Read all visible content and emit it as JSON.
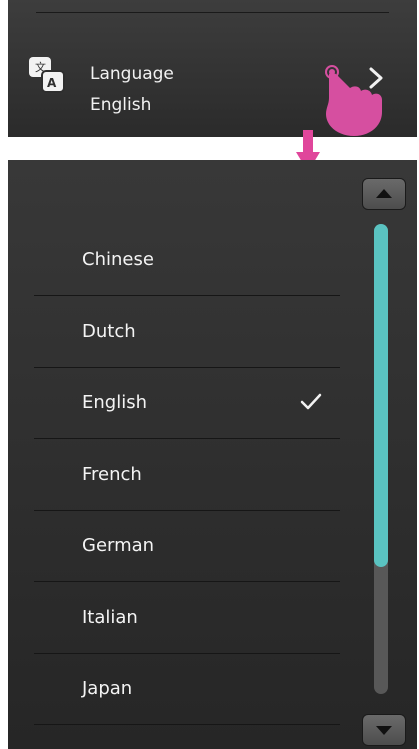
{
  "settings": {
    "language_title": "Language",
    "language_value": "English",
    "icon": "translate-icon",
    "chevron_icon": "chevron-right-icon",
    "tap_indicator_icon": "tap-hand-icon"
  },
  "language_list": {
    "items": [
      {
        "label": "Chinese",
        "selected": false
      },
      {
        "label": "Dutch",
        "selected": false
      },
      {
        "label": "English",
        "selected": true
      },
      {
        "label": "French",
        "selected": false
      },
      {
        "label": "German",
        "selected": false
      },
      {
        "label": "Italian",
        "selected": false
      },
      {
        "label": "Japan",
        "selected": false
      }
    ],
    "check_icon": "checkmark-icon",
    "scroll_position": 0.0,
    "visible_fraction": 0.73
  },
  "colors": {
    "accent": "#5ac3c1",
    "annotation": "#d64fa0",
    "panel": "#333333",
    "text": "#f2f2f2"
  }
}
